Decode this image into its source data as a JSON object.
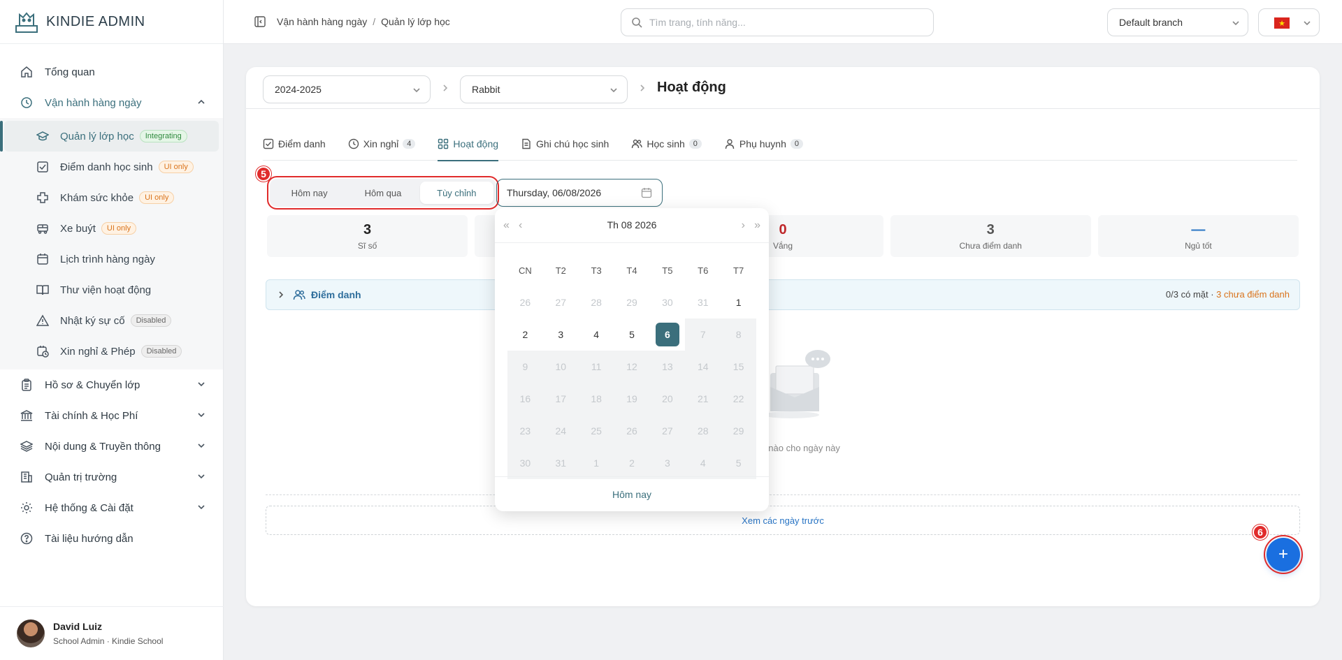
{
  "brand": {
    "name": "KINDIE ADMIN"
  },
  "sidebar": {
    "items": [
      {
        "label": "Tổng quan",
        "icon": "home-icon"
      },
      {
        "label": "Vận hành hàng ngày",
        "icon": "clock-icon"
      },
      {
        "label": "Hồ sơ & Chuyển lớp",
        "icon": "clipboard-icon"
      },
      {
        "label": "Tài chính & Học Phí",
        "icon": "bank-icon"
      },
      {
        "label": "Nội dung & Truyền thông",
        "icon": "layers-icon"
      },
      {
        "label": "Quản trị trường",
        "icon": "building-icon"
      },
      {
        "label": "Hệ thống & Cài đặt",
        "icon": "gear-icon"
      },
      {
        "label": "Tài liệu hướng dẫn",
        "icon": "help-icon"
      }
    ],
    "sub_items": [
      {
        "label": "Quản lý lớp học",
        "badge": "Integrating",
        "icon": "graduation-cap-icon"
      },
      {
        "label": "Điểm danh học sinh",
        "badge": "UI only",
        "icon": "checkbox-icon"
      },
      {
        "label": "Khám sức khỏe",
        "badge": "UI only",
        "icon": "plus-cross-icon"
      },
      {
        "label": "Xe buýt",
        "badge": "UI only",
        "icon": "bus-icon"
      },
      {
        "label": "Lịch trình hàng ngày",
        "badge": "",
        "icon": "calendar-icon"
      },
      {
        "label": "Thư viện hoạt động",
        "badge": "",
        "icon": "book-icon"
      },
      {
        "label": "Nhật ký sự cố",
        "badge": "Disabled",
        "icon": "warning-icon"
      },
      {
        "label": "Xin nghỉ & Phép",
        "badge": "Disabled",
        "icon": "calendar-clock-icon"
      }
    ]
  },
  "user": {
    "name": "David Luiz",
    "role": "School Admin · Kindie School"
  },
  "topbar": {
    "breadcrumb": [
      "Vận hành hàng ngày",
      "Quản lý lớp học"
    ],
    "search_placeholder": "Tìm trang, tính năng...",
    "branch": "Default branch"
  },
  "card": {
    "year": "2024-2025",
    "class": "Rabbit",
    "title": "Hoạt động"
  },
  "tabs": [
    {
      "label": "Điểm danh",
      "count": ""
    },
    {
      "label": "Xin nghỉ",
      "count": "4"
    },
    {
      "label": "Hoạt động",
      "count": ""
    },
    {
      "label": "Ghi chú học sinh",
      "count": ""
    },
    {
      "label": "Học sinh",
      "count": "0"
    },
    {
      "label": "Phụ huynh",
      "count": "0"
    }
  ],
  "filter": {
    "options": [
      "Hôm nay",
      "Hôm qua",
      "Tùy chỉnh"
    ],
    "selected": "Tùy chỉnh",
    "date_value": "Thursday, 06/08/2026"
  },
  "markers": {
    "m5": "5",
    "m6": "6"
  },
  "stats": [
    {
      "value": "3",
      "label": "Sĩ số"
    },
    {
      "value": "",
      "label": ""
    },
    {
      "value": "0",
      "label": "Vắng"
    },
    {
      "value": "3",
      "label": "Chưa điểm danh"
    },
    {
      "value": "—",
      "label": "Ngủ tốt"
    }
  ],
  "section": {
    "title": "Điểm danh",
    "summary": "0/3 có mặt · ",
    "warn": "3 chưa điểm danh"
  },
  "empty": {
    "text": "ộng nào cho ngày này"
  },
  "more_button": "Xem các ngày trước",
  "fab": "+",
  "calendar": {
    "title": "Th 08  2026",
    "weekdays": [
      "CN",
      "T2",
      "T3",
      "T4",
      "T5",
      "T6",
      "T7"
    ],
    "weeks": [
      [
        "26",
        "27",
        "28",
        "29",
        "30",
        "31",
        "1"
      ],
      [
        "2",
        "3",
        "4",
        "5",
        "6",
        "7",
        "8"
      ],
      [
        "9",
        "10",
        "11",
        "12",
        "13",
        "14",
        "15"
      ],
      [
        "16",
        "17",
        "18",
        "19",
        "20",
        "21",
        "22"
      ],
      [
        "23",
        "24",
        "25",
        "26",
        "27",
        "28",
        "29"
      ],
      [
        "30",
        "31",
        "1",
        "2",
        "3",
        "4",
        "5"
      ]
    ],
    "selected_day": "6",
    "today_label": "Hôm nay"
  },
  "colors": {
    "accent": "#3b6f7c",
    "fab": "#1a6fe0",
    "marker": "#e02b2b"
  }
}
